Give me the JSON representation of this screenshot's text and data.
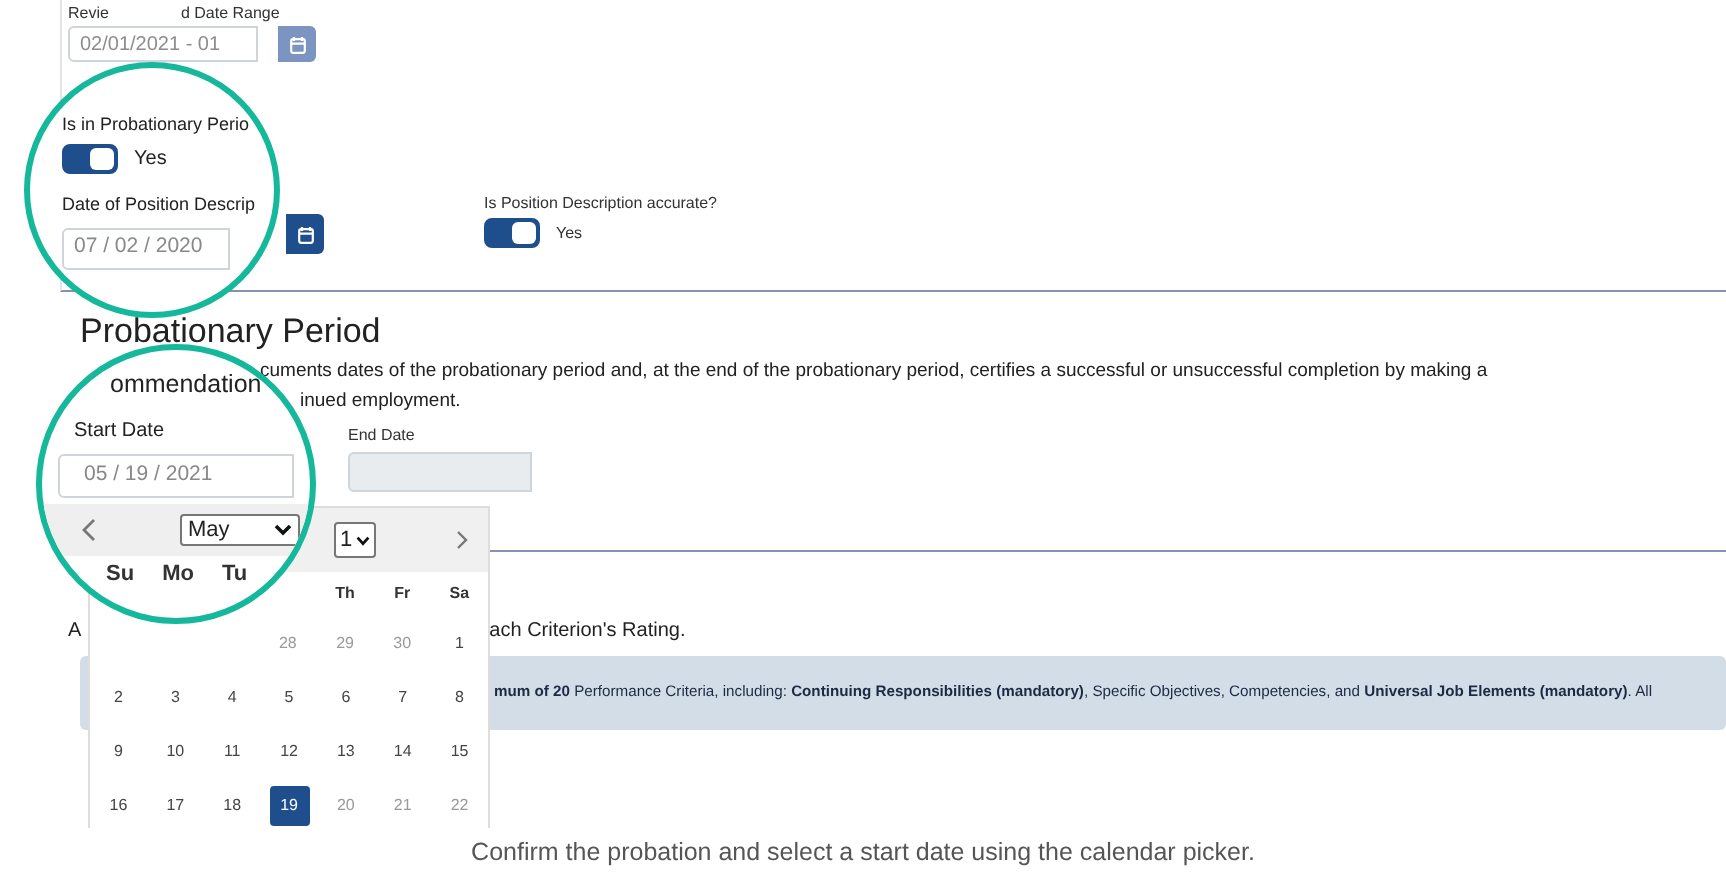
{
  "review_period": {
    "label_start": "Revie",
    "label_end": "d Date Range",
    "value": "02/01/2021 - 01"
  },
  "magnifier_1": {
    "probationary_label": "Is in Probationary Perio",
    "probationary_toggle": {
      "on": true,
      "label": "Yes"
    },
    "position_date_label": "Date of Position Descrip",
    "position_date_value": "07 / 02 / 2020"
  },
  "position_accurate": {
    "label": "Is Position Description accurate?",
    "on": true,
    "toggle_label": "Yes"
  },
  "section": {
    "title": "Probationary Period",
    "text_line_1": "cuments dates of the probationary period and, at the end of the probationary period, certifies a successful or unsuccessful completion by making a",
    "text_line_2": "inued employment."
  },
  "magnifier_2": {
    "word": "ommendation",
    "start_date_label": "Start Date",
    "start_date_value": "05 / 19 / 2021",
    "month": "May",
    "weekdays": [
      "Su",
      "Mo",
      "Tu"
    ]
  },
  "end_date": {
    "label": "End Date"
  },
  "calendar": {
    "year": "1",
    "weekdays": [
      "Th",
      "Fr",
      "Sa"
    ],
    "weeks": [
      [
        {
          "day": "28",
          "disabled": true,
          "selected": false
        },
        {
          "day": "29",
          "disabled": true,
          "selected": false
        },
        {
          "day": "30",
          "disabled": true,
          "selected": false
        },
        {
          "day": "1",
          "disabled": false,
          "selected": false
        }
      ],
      [
        {
          "day": "2",
          "disabled": false,
          "selected": false
        },
        {
          "day": "3",
          "disabled": false,
          "selected": false
        },
        {
          "day": "4",
          "disabled": false,
          "selected": false
        },
        {
          "day": "5",
          "disabled": false,
          "selected": false
        },
        {
          "day": "6",
          "disabled": false,
          "selected": false
        },
        {
          "day": "7",
          "disabled": false,
          "selected": false
        },
        {
          "day": "8",
          "disabled": false,
          "selected": false
        }
      ],
      [
        {
          "day": "9",
          "disabled": false,
          "selected": false
        },
        {
          "day": "10",
          "disabled": false,
          "selected": false
        },
        {
          "day": "11",
          "disabled": false,
          "selected": false
        },
        {
          "day": "12",
          "disabled": false,
          "selected": false
        },
        {
          "day": "13",
          "disabled": false,
          "selected": false
        },
        {
          "day": "14",
          "disabled": false,
          "selected": false
        },
        {
          "day": "15",
          "disabled": false,
          "selected": false
        }
      ],
      [
        {
          "day": "16",
          "disabled": false,
          "selected": false
        },
        {
          "day": "17",
          "disabled": false,
          "selected": false
        },
        {
          "day": "18",
          "disabled": false,
          "selected": false
        },
        {
          "day": "19",
          "disabled": false,
          "selected": true
        },
        {
          "day": "20",
          "disabled": true,
          "selected": false
        },
        {
          "day": "21",
          "disabled": true,
          "selected": false
        },
        {
          "day": "22",
          "disabled": true,
          "selected": false
        }
      ]
    ]
  },
  "criteria": {
    "text_start": "A",
    "text_end": "ach Criterion's Rating.",
    "alert": "**mum of 20** Performance Criteria, including: **Continuing Responsibilities (mandatory)**, Specific Objectives, Competencies, and **Universal Job Elements (mandatory)**. All"
  },
  "caption": "Confirm the probation and select a start date using the calendar picker."
}
